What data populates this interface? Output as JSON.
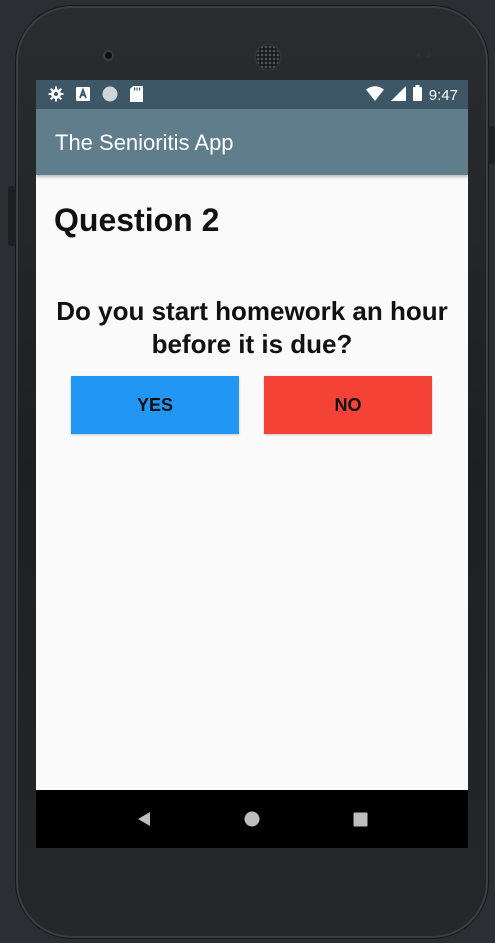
{
  "status_bar": {
    "time": "9:47",
    "icons": [
      "settings-icon",
      "a-notification-icon",
      "circle-icon",
      "sd-card-icon",
      "wifi-icon",
      "signal-icon",
      "battery-icon"
    ]
  },
  "app_bar": {
    "title": "The Senioritis App"
  },
  "main": {
    "question_number": "Question 2",
    "question_text": "Do you start homework an hour before it is due?",
    "yes_label": "YES",
    "no_label": "NO"
  },
  "nav": {
    "icons": [
      "back-icon",
      "home-icon",
      "recents-icon"
    ]
  },
  "colors": {
    "status_bar": "#3e5766",
    "app_bar": "#607d8b",
    "yes_button": "#2196f3",
    "no_button": "#f44336",
    "background": "#fafafa"
  }
}
